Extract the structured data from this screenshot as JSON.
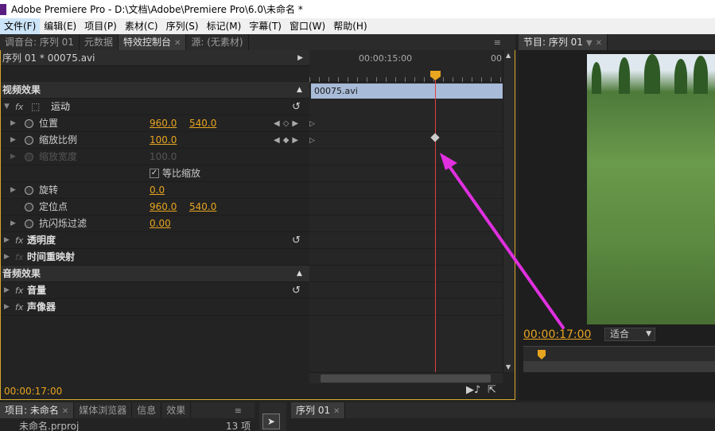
{
  "window": {
    "title": "Adobe Premiere Pro - D:\\文档\\Adobe\\Premiere Pro\\6.0\\未命名 *"
  },
  "menu": [
    "文件(F)",
    "编辑(E)",
    "项目(P)",
    "素材(C)",
    "序列(S)",
    "标记(M)",
    "字幕(T)",
    "窗口(W)",
    "帮助(H)"
  ],
  "source_panel": {
    "tabs": [
      "调音台: 序列 01",
      "元数据",
      "特效控制台",
      "源: (无素材)"
    ],
    "menu_icon": "≡"
  },
  "program_panel": {
    "tab": "节目: 序列 01"
  },
  "effect_controls": {
    "sequence_clip": "序列 01 * 00075.avi",
    "timecode_top": "00:00:15:00",
    "timecode_right": "00",
    "clip_name": "00075.avi",
    "video_effects": "视频效果",
    "motion": "运动",
    "position": {
      "label": "位置",
      "x": "960.0",
      "y": "540.0"
    },
    "scale": {
      "label": "缩放比例",
      "value": "100.0"
    },
    "scale_width": {
      "label": "缩放宽度",
      "value": "100.0"
    },
    "uniform_scale": "等比缩放",
    "rotation": {
      "label": "旋转",
      "value": "0.0"
    },
    "anchor": {
      "label": "定位点",
      "x": "960.0",
      "y": "540.0"
    },
    "anti_flicker": {
      "label": "抗闪烁过滤",
      "value": "0.00"
    },
    "opacity": "透明度",
    "time_remap": "时间重映射",
    "audio_effects": "音频效果",
    "volume": "音量",
    "panner": "声像器",
    "current_time": "00:00:17:00"
  },
  "program_monitor": {
    "timecode": "00:00:17:00",
    "fit": "适合"
  },
  "bottom_panels": {
    "project_tabs": [
      "项目: 未命名",
      "媒体浏览器",
      "信息",
      "效果"
    ],
    "project_file": "未命名.prproj",
    "item_count": "13 项",
    "sequence_tab": "序列 01"
  }
}
